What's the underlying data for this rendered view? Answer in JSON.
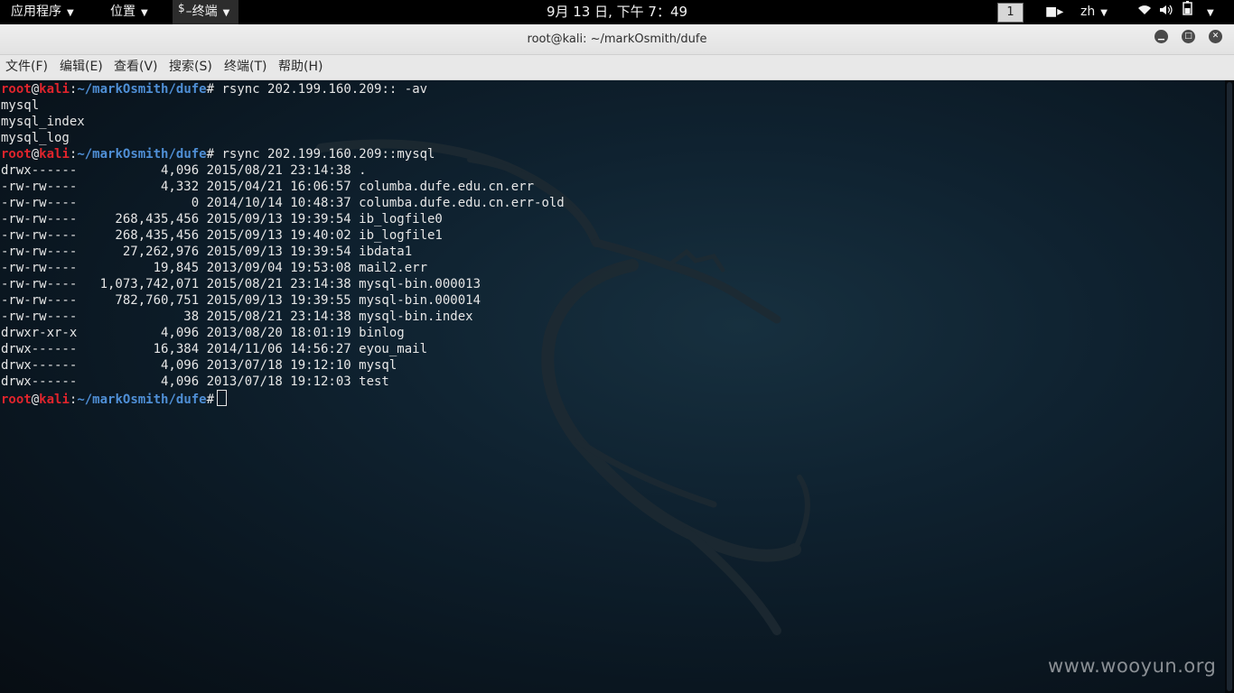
{
  "top_panel": {
    "apps_menu": "应用程序",
    "places_menu": "位置",
    "terminal_menu": "终端",
    "terminal_menu_prefix": "$",
    "clock": "9月 13 日, 下午 7：49",
    "workspace": "1",
    "language": "zh"
  },
  "window": {
    "title": "root@kali: ~/markOsmith/dufe"
  },
  "menubar": {
    "file": "文件(F)",
    "edit": "编辑(E)",
    "view": "查看(V)",
    "search": "搜索(S)",
    "terminal": "终端(T)",
    "help": "帮助(H)"
  },
  "terminal": {
    "prompt": {
      "user": "root",
      "at": "@",
      "host": "kali",
      "colon": ":",
      "path": "~/markOsmith/dufe",
      "symbol": "#"
    },
    "lines": [
      {
        "type": "prompt",
        "cmd": " rsync 202.199.160.209:: -av"
      },
      {
        "type": "out",
        "text": "mysql"
      },
      {
        "type": "out",
        "text": "mysql_index"
      },
      {
        "type": "out",
        "text": "mysql_log"
      },
      {
        "type": "prompt",
        "cmd": " rsync 202.199.160.209::mysql"
      },
      {
        "type": "out",
        "text": "drwx------           4,096 2015/08/21 23:14:38 ."
      },
      {
        "type": "out",
        "text": "-rw-rw----           4,332 2015/04/21 16:06:57 columba.dufe.edu.cn.err"
      },
      {
        "type": "out",
        "text": "-rw-rw----               0 2014/10/14 10:48:37 columba.dufe.edu.cn.err-old"
      },
      {
        "type": "out",
        "text": "-rw-rw----     268,435,456 2015/09/13 19:39:54 ib_logfile0"
      },
      {
        "type": "out",
        "text": "-rw-rw----     268,435,456 2015/09/13 19:40:02 ib_logfile1"
      },
      {
        "type": "out",
        "text": "-rw-rw----      27,262,976 2015/09/13 19:39:54 ibdata1"
      },
      {
        "type": "out",
        "text": "-rw-rw----          19,845 2013/09/04 19:53:08 mail2.err"
      },
      {
        "type": "out",
        "text": "-rw-rw----   1,073,742,071 2015/08/21 23:14:38 mysql-bin.000013"
      },
      {
        "type": "out",
        "text": "-rw-rw----     782,760,751 2015/09/13 19:39:55 mysql-bin.000014"
      },
      {
        "type": "out",
        "text": "-rw-rw----              38 2015/08/21 23:14:38 mysql-bin.index"
      },
      {
        "type": "out",
        "text": "drwxr-xr-x           4,096 2013/08/20 18:01:19 binlog"
      },
      {
        "type": "out",
        "text": "drwx------          16,384 2014/11/06 14:56:27 eyou_mail"
      },
      {
        "type": "out",
        "text": "drwx------           4,096 2013/07/18 19:12:10 mysql"
      },
      {
        "type": "out",
        "text": "drwx------           4,096 2013/07/18 19:12:03 test"
      },
      {
        "type": "prompt",
        "cmd": "",
        "cursor": true
      }
    ]
  },
  "watermark": "www.wooyun.org"
}
